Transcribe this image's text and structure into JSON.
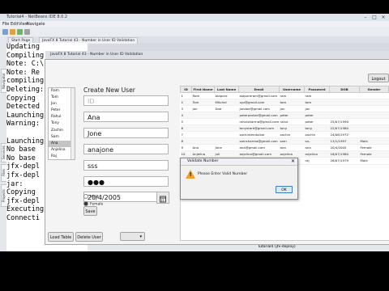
{
  "ide": {
    "title": "Tutorial4 - NetBeans IDE 8.0.2",
    "menu": [
      "File",
      "Edit",
      "View",
      "Navigate",
      "Source",
      "Refactor",
      "Run",
      "Debug",
      "Profile",
      "Team",
      "Tools",
      "Window",
      "Help"
    ],
    "side_tabs": [
      "Navigator",
      "Projects",
      "Services",
      "Files"
    ],
    "file_tabs": [
      "Start Page",
      "JavaFX 8 Tutorial 43 - Number in User ID Validation"
    ],
    "output_lines": [
      "Updating",
      "Compiling",
      "Note: C:\\",
      "Note: Re",
      "compiling",
      "Deleting:",
      "Copying",
      "Detected",
      "Launching",
      "Warning:",
      "",
      "Launching",
      "No base",
      "No base",
      "jfx-depl",
      "jfx-depl",
      "jar:",
      "Copying",
      "jfx-depl",
      "Executing",
      "Connecti"
    ],
    "status_text": "Tutorial4 (jfx-deploy)"
  },
  "app": {
    "window_title": "JavaFX 8 Tutorial 43 - Number in User ID Validation",
    "heading": "Create New User",
    "list_items": [
      "Ram",
      "Tom",
      "Jon",
      "Peter",
      "Rahul",
      "Tony",
      "Zachin",
      "Sam",
      "Ana",
      "Anjelina",
      "Raj"
    ],
    "selected_index": 8,
    "fields": {
      "id_placeholder": "ID",
      "first_name": "Ana",
      "last_name": "Jone",
      "email": "anajone",
      "username": "sss",
      "password": "●●●",
      "dob": "20/4/2005"
    },
    "gender": {
      "male_label": "Male",
      "female_label": "Female",
      "selected": "Female"
    },
    "buttons": {
      "save": "Save",
      "load_table": "Load Table",
      "delete_user": "Delete User",
      "logout": "Logout"
    },
    "table": {
      "headers": [
        "ID",
        "First Name",
        "Last Name",
        "Email",
        "Username",
        "Password",
        "DOB",
        "Gender"
      ],
      "rows": [
        [
          "1",
          "Ram",
          "Alapure",
          "alapureram@gmail.com",
          "ram",
          "ram",
          "",
          ""
        ],
        [
          "2",
          "Tom",
          "Mitchel",
          "xyz@gmail.com",
          "tom",
          "tom",
          "",
          ""
        ],
        [
          "3",
          "Jon",
          "Doe",
          "jondoe@gmail.com",
          "jon",
          "jon",
          "",
          ""
        ],
        [
          "4",
          "",
          "",
          "peterparker@gmail.com",
          "peter",
          "peter",
          "",
          ""
        ],
        [
          "5",
          "",
          "",
          "rahulsharma@gmail.com",
          "rahul",
          "peter",
          "25/07/1990",
          ""
        ],
        [
          "6",
          "",
          "",
          "tonystark@gmail.com",
          "tony",
          "tony",
          "22/07/1980",
          ""
        ],
        [
          "7",
          "",
          "",
          "sachintendulkar",
          "zachin",
          "zachin",
          "24/06/1972",
          ""
        ],
        [
          "8",
          "",
          "",
          "samcharma@gmail.com",
          "sam",
          "sa..",
          "13/1/1997",
          "Male"
        ],
        [
          "9",
          "Ana",
          "Jone",
          "ana@gmail.com",
          "ana",
          "ana",
          "20/4/2005",
          "Female"
        ],
        [
          "10",
          "Anjelina",
          "Juli",
          "anjelina@gmail.com",
          "anjelina",
          "anjelina",
          "16/07/1980",
          "Female"
        ],
        [
          "11",
          "Raj",
          "Malhotra",
          "raj123@gmail.com",
          "raj",
          "raj",
          "26/07/1979",
          "Male"
        ]
      ]
    },
    "dialog": {
      "title": "Validate Number",
      "message": "Please Enter Valid Number",
      "ok": "OK"
    }
  },
  "colors": {
    "warning_icon": "#f0a32c",
    "dialog_ok_border": "#3b7fc4",
    "list_selected": "#c4c4c4"
  }
}
